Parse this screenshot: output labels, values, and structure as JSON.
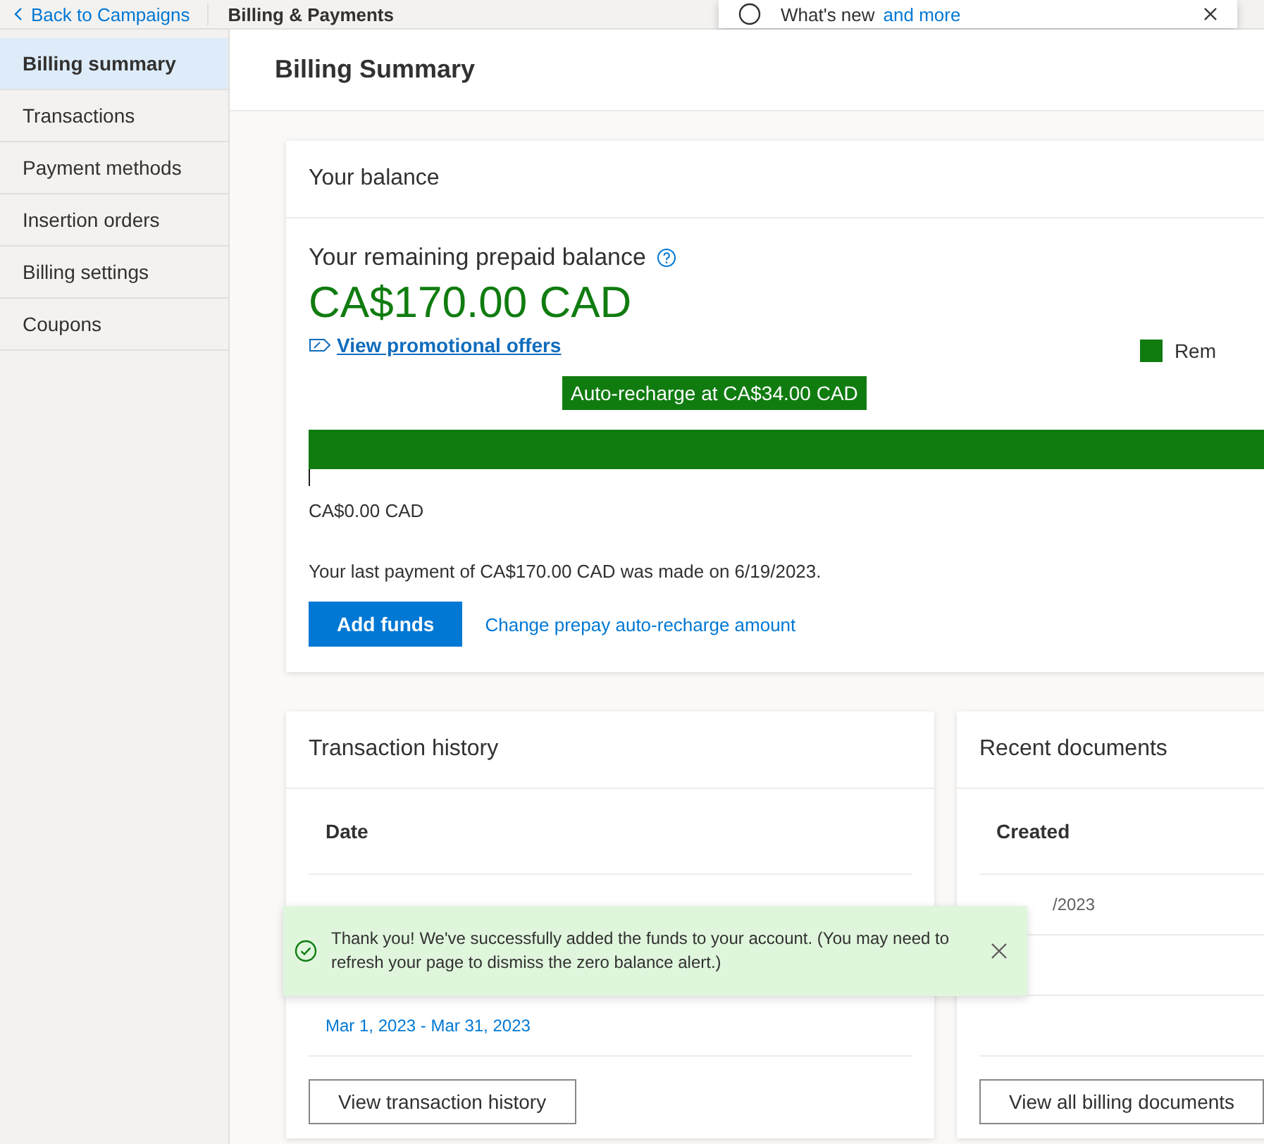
{
  "top_bar": {
    "back_link": "Back to Campaigns",
    "section_title": "Billing & Payments",
    "notice": {
      "text": "What's new",
      "link": "and more"
    }
  },
  "sidebar": {
    "items": [
      {
        "label": "Billing summary",
        "selected": true
      },
      {
        "label": "Transactions",
        "selected": false
      },
      {
        "label": "Payment methods",
        "selected": false
      },
      {
        "label": "Insertion orders",
        "selected": false
      },
      {
        "label": "Billing settings",
        "selected": false
      },
      {
        "label": "Coupons",
        "selected": false
      }
    ]
  },
  "page_title": "Billing Summary",
  "balance_card": {
    "title": "Your balance",
    "subtitle": "Your remaining prepaid balance",
    "amount": "CA$170.00 CAD",
    "promo_link": "View promotional offers",
    "legend": "Rem",
    "recharge_marker": "Auto-recharge at CA$34.00 CAD",
    "min_label": "CA$0.00 CAD",
    "last_payment": "Your last payment of CA$170.00 CAD was made on 6/19/2023.",
    "primary_button": "Add funds",
    "secondary_link": "Change prepay auto-recharge amount"
  },
  "transaction_card": {
    "title": "Transaction history",
    "columns": [
      "Date"
    ],
    "rows": [
      {
        "date": "Mar 1, 2023 - Mar 31, 2023"
      }
    ],
    "button": "View transaction history"
  },
  "documents_card": {
    "title": "Recent documents",
    "columns": [
      "Created"
    ],
    "rows": [
      {
        "created": "/2023"
      }
    ],
    "button": "View all billing documents"
  },
  "toast": {
    "kind": "success",
    "message": "Thank you! We've successfully added the funds to your account. (You may need to refresh your page to dismiss the zero balance alert.)"
  }
}
